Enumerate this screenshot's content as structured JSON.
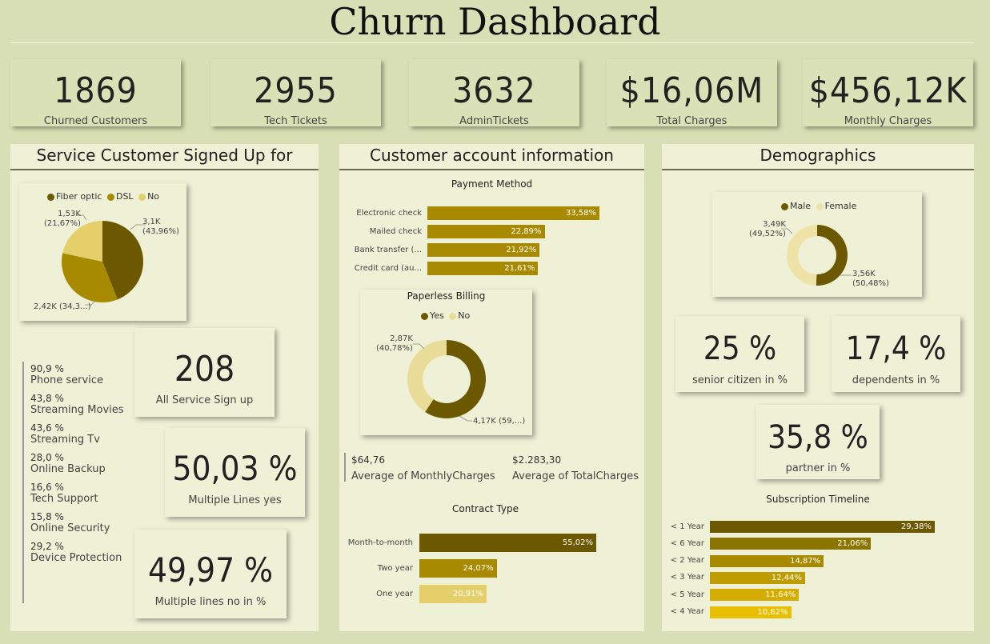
{
  "title": "Churn Dashboard",
  "kpis": [
    {
      "value": "1869",
      "label": "Churned Customers"
    },
    {
      "value": "2955",
      "label": "Tech Tickets"
    },
    {
      "value": "3632",
      "label": "AdminTickets"
    },
    {
      "value": "$16,06M",
      "label": "Total Charges"
    },
    {
      "value": "$456,12K",
      "label": "Monthly Charges"
    }
  ],
  "service": {
    "title": "Service Customer Signed Up for",
    "pie": {
      "legend": [
        "Fiber optic",
        "DSL",
        "No"
      ],
      "colors": [
        "#6b5800",
        "#a88a00",
        "#e5cf6a"
      ],
      "values": [
        43.96,
        34.37,
        21.67
      ],
      "labels": {
        "fiber": "3,1K\n(43,96%)",
        "dsl": "2,42K (34,3...)",
        "no": "1,53K\n(21,67%)"
      }
    },
    "list": [
      {
        "pct": "90,9 %",
        "name": "Phone service"
      },
      {
        "pct": "43,8 %",
        "name": "Streaming Movies"
      },
      {
        "pct": "43,6 %",
        "name": "Streaming Tv"
      },
      {
        "pct": "28,0 %",
        "name": "Online Backup"
      },
      {
        "pct": "16,6 %",
        "name": "Tech Support"
      },
      {
        "pct": "15,8 %",
        "name": "Online Security"
      },
      {
        "pct": "29,2 %",
        "name": "Device Protection"
      }
    ],
    "all_signup": {
      "value": "208",
      "label": "All Service Sign up"
    },
    "multi_yes": {
      "value": "50,03 %",
      "label": "Multiple Lines yes"
    },
    "multi_no": {
      "value": "49,97 %",
      "label": "Multiple lines no in %"
    }
  },
  "account": {
    "title": "Customer account information",
    "payment": {
      "title": "Payment Method",
      "items": [
        {
          "label": "Electronic check",
          "value": 33.58,
          "text": "33,58%"
        },
        {
          "label": "Mailed check",
          "value": 22.89,
          "text": "22,89%"
        },
        {
          "label": "Bank transfer (...",
          "value": 21.92,
          "text": "21,92%"
        },
        {
          "label": "Credit card (au...",
          "value": 21.61,
          "text": "21,61%"
        }
      ],
      "color": "#a88a00"
    },
    "paperless": {
      "title": "Paperless Billing",
      "legend": [
        "Yes",
        "No"
      ],
      "colors": [
        "#6b5800",
        "#e9dc99"
      ],
      "values": [
        59.22,
        40.78
      ],
      "label_yes": "4,17K (59,...)",
      "label_no": "2,87K\n(40,78%)"
    },
    "avg_monthly": {
      "value": "$64,76",
      "label": "Average of MonthlyCharges"
    },
    "avg_total": {
      "value": "$2.283,30",
      "label": "Average of TotalCharges"
    },
    "contract": {
      "title": "Contract Type",
      "items": [
        {
          "label": "Month-to-month",
          "value": 55.02,
          "text": "55,02%",
          "color": "#6b5800"
        },
        {
          "label": "Two year",
          "value": 24.07,
          "text": "24,07%",
          "color": "#a88a00"
        },
        {
          "label": "One year",
          "value": 20.91,
          "text": "20,91%",
          "color": "#e5cf6a"
        }
      ]
    }
  },
  "demo": {
    "title": "Demographics",
    "gender": {
      "legend": [
        "Male",
        "Female"
      ],
      "colors": [
        "#6b5800",
        "#efe2a6"
      ],
      "values": [
        50.48,
        49.52
      ],
      "label_male": "3,56K\n(50,48%)",
      "label_female": "3,49K\n(49,52%)"
    },
    "senior": {
      "value": "25 %",
      "label": "senior citizen in %"
    },
    "dependents": {
      "value": "17,4 %",
      "label": "dependents in %"
    },
    "partner": {
      "value": "35,8 %",
      "label": "partner in %"
    },
    "timeline": {
      "title": "Subscription Timeline",
      "items": [
        {
          "label": "< 1 Year",
          "value": 29.38,
          "text": "29,38%",
          "color": "#6b5800"
        },
        {
          "label": "< 6 Year",
          "value": 21.06,
          "text": "21,06%",
          "color": "#8c7400"
        },
        {
          "label": "< 2 Year",
          "value": 14.87,
          "text": "14,87%",
          "color": "#a88a00"
        },
        {
          "label": "< 3 Year",
          "value": 12.44,
          "text": "12,44%",
          "color": "#bf9d00"
        },
        {
          "label": "< 5 Year",
          "value": 11.64,
          "text": "11,64%",
          "color": "#d4ad00"
        },
        {
          "label": "< 4 Year",
          "value": 10.62,
          "text": "10,62%",
          "color": "#e8bf00"
        }
      ]
    }
  }
}
